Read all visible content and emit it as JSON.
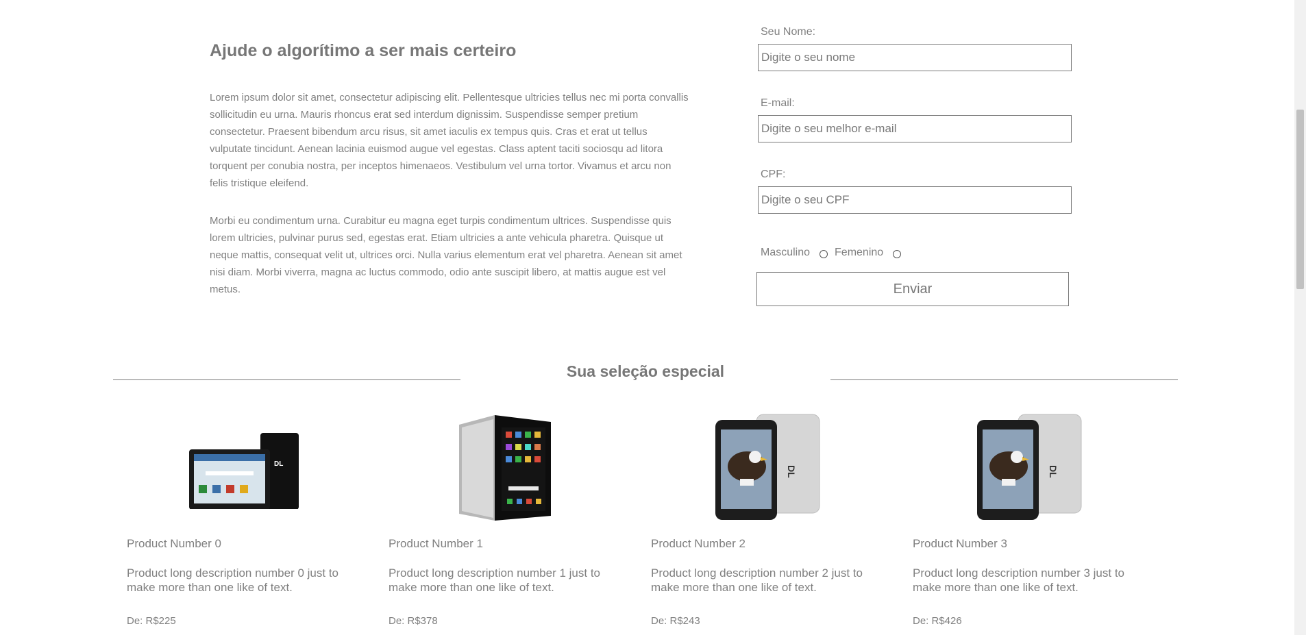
{
  "intro": {
    "title": "Ajude o algorítimo a ser mais certeiro",
    "paragraph1": "Lorem ipsum dolor sit amet, consectetur adipiscing elit. Pellentesque ultricies tellus nec mi porta convallis sollicitudin eu urna. Mauris rhoncus erat sed interdum dignissim. Suspendisse semper pretium consectetur. Praesent bibendum arcu risus, sit amet iaculis ex tempus quis. Cras et erat ut tellus vulputate tincidunt. Aenean lacinia euismod augue vel egestas. Class aptent taciti sociosqu ad litora torquent per conubia nostra, per inceptos himenaeos. Vestibulum vel urna tortor. Vivamus et arcu non felis tristique eleifend.",
    "paragraph2": "Morbi eu condimentum urna. Curabitur eu magna eget turpis condimentum ultrices. Suspendisse quis lorem ultricies, pulvinar purus sed, egestas erat. Etiam ultricies a ante vehicula pharetra. Quisque ut neque mattis, consequat velit ut, ultrices orci. Nulla varius elementum erat vel pharetra. Aenean sit amet nisi diam. Morbi viverra, magna ac luctus commodo, odio ante suscipit libero, at mattis augue est vel metus."
  },
  "form": {
    "name_label": "Seu Nome:",
    "name_placeholder": "Digite o seu nome",
    "email_label": "E-mail:",
    "email_placeholder": "Digite o seu melhor e-mail",
    "cpf_label": "CPF:",
    "cpf_placeholder": "Digite o seu CPF",
    "gender_male": "Masculino",
    "gender_female": "Femenino",
    "submit_label": "Enviar"
  },
  "selection": {
    "title": "Sua seleção especial",
    "products": [
      {
        "name": "Product Number 0",
        "description": "Product long description number 0 just to make more than one like of text.",
        "price": "De: R$225",
        "image": "tablet-landscape-black"
      },
      {
        "name": "Product Number 1",
        "description": "Product long description number 1 just to make more than one like of text.",
        "price": "De: R$378",
        "image": "tablet-portrait-silver"
      },
      {
        "name": "Product Number 2",
        "description": "Product long description number 2 just to make more than one like of text.",
        "price": "De: R$243",
        "image": "tablet-eagle-screen"
      },
      {
        "name": "Product Number 3",
        "description": "Product long description number 3 just to make more than one like of text.",
        "price": "De: R$426",
        "image": "tablet-eagle-screen"
      }
    ]
  }
}
